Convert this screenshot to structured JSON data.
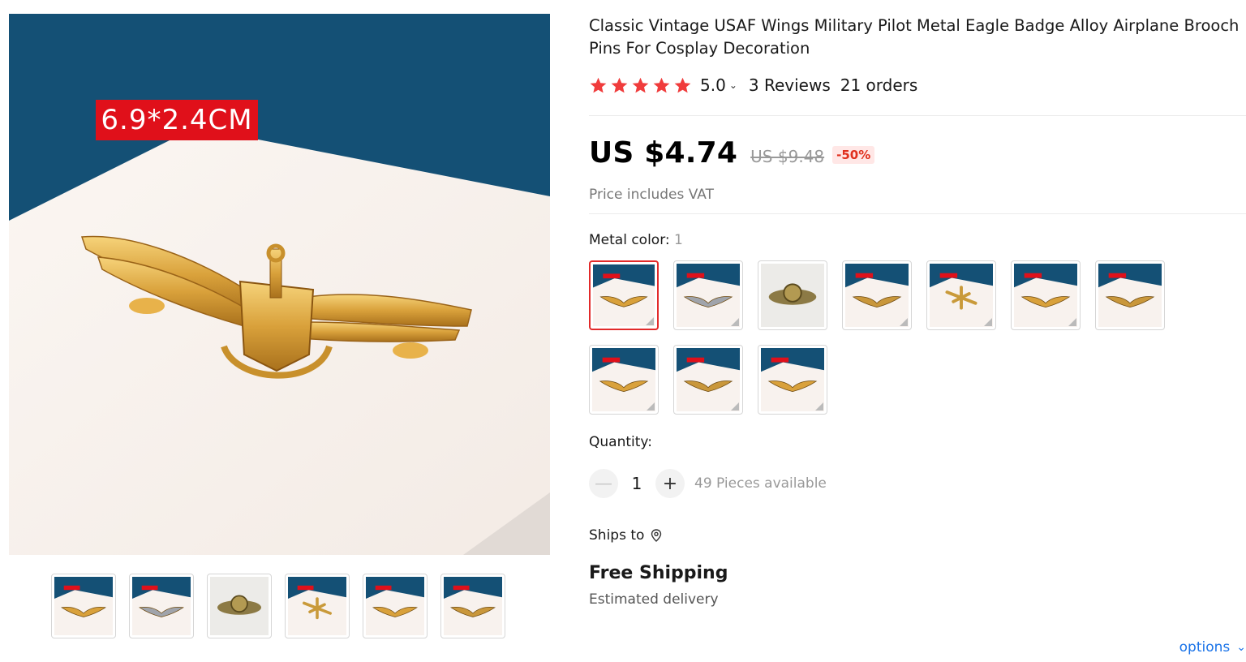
{
  "product": {
    "title": "Classic Vintage USAF Wings Military Pilot Metal Eagle Badge Alloy Airplane Brooch Pins For Cosplay Decoration",
    "rating_value": "5.0",
    "stars": 5,
    "reviews": "3 Reviews",
    "orders": "21 orders"
  },
  "main_image": {
    "size_label": "6.9*2.4CM"
  },
  "gallery": {
    "thumbnails": [
      "gold-anchor-wings",
      "silver-wings",
      "gold-round-badge",
      "gold-airplane",
      "gold-wings",
      "gold-wings-2"
    ]
  },
  "price": {
    "current": "US $4.74",
    "original": "US $9.48",
    "discount": "-50%",
    "vat_note": "Price includes VAT"
  },
  "variants": {
    "label": "Metal color:",
    "selected_value": "1",
    "options": [
      "1",
      "2",
      "3",
      "4",
      "5",
      "6",
      "7",
      "8",
      "9",
      "10"
    ]
  },
  "quantity": {
    "label": "Quantity:",
    "minus": "—",
    "value": "1",
    "plus": "+",
    "available": "49 Pieces available"
  },
  "shipping": {
    "ships_to": "Ships to",
    "free_shipping": "Free Shipping",
    "estimated": "Estimated delivery"
  },
  "footer": {
    "options_link": "options"
  },
  "colors": {
    "accent_red": "#e22a2a",
    "star": "#f03c3c",
    "backdrop_blue": "#145075",
    "link_blue": "#1a73e8"
  }
}
